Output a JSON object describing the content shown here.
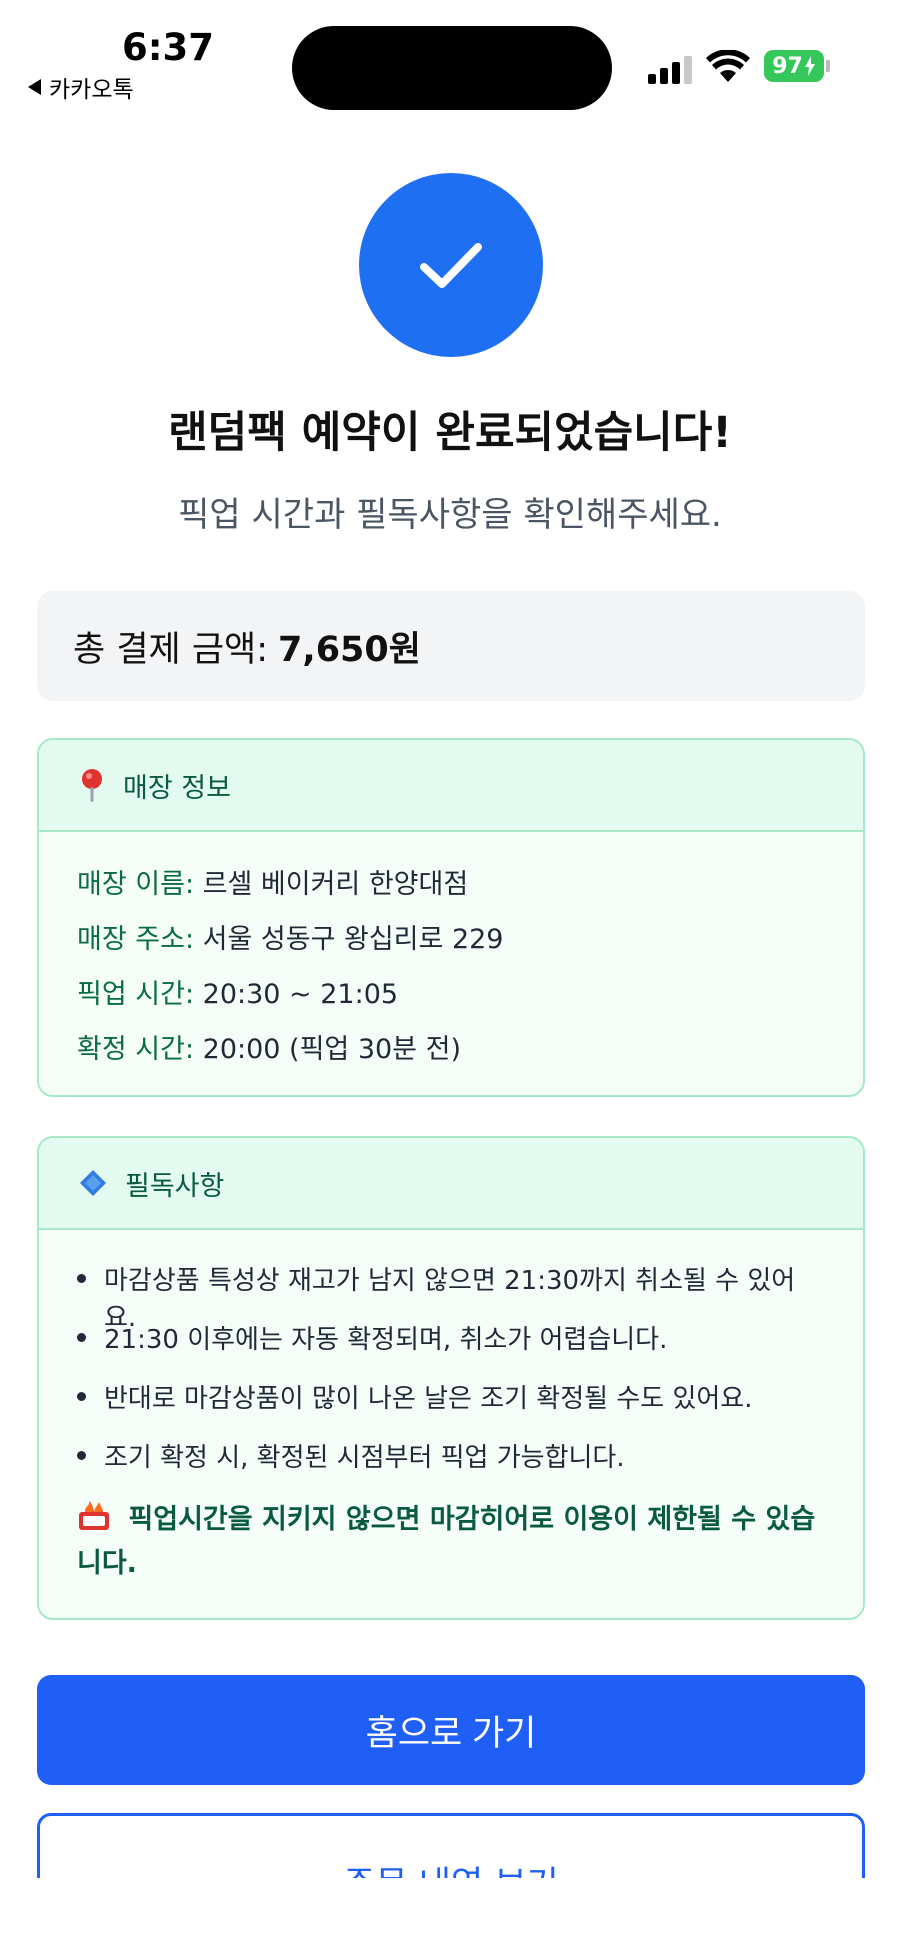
{
  "status_bar": {
    "time": "6:37",
    "back_app": "카카오톡",
    "battery": "97"
  },
  "confirmation": {
    "icon": "check-icon",
    "title": "랜덤팩 예약이 완료되었습니다!",
    "subtitle": "픽업 시간과 필독사항을 확인해주세요."
  },
  "total": {
    "label": "총 결제 금액:",
    "amount": "7,650원"
  },
  "store_card": {
    "title": "매장 정보",
    "rows": [
      {
        "label": "매장 이름:",
        "value": "르셀 베이커리 한양대점"
      },
      {
        "label": "매장 주소:",
        "value": "서울 성동구 왕십리로 229"
      },
      {
        "label": "픽업 시간:",
        "value": "20:30 ~ 21:05"
      },
      {
        "label": "확정 시간:",
        "value": "20:00 (픽업 30분 전)"
      }
    ]
  },
  "notice_card": {
    "title": "필독사항",
    "items": [
      "마감상품 특성상 재고가 남지 않으면 21:30까지 취소될 수 있어요.",
      "21:30 이후에는 자동 확정되며, 취소가 어렵습니다.",
      "반대로 마감상품이 많이 나온 날은 조기 확정될 수도 있어요.",
      "조기 확정 시, 확정된 시점부터 픽업 가능합니다."
    ],
    "warning": "픽업시간을 지키지 않으면 마감히어로 이용이 제한될 수 있습니다."
  },
  "buttons": {
    "home": "홈으로 가기",
    "orders": "주문 내역 보기"
  },
  "colors": {
    "primary": "#1f5ff5",
    "check_circle": "#1f6ff2",
    "card_border": "#a7e8c9",
    "card_label": "#0a6b48",
    "battery": "#34c759"
  }
}
